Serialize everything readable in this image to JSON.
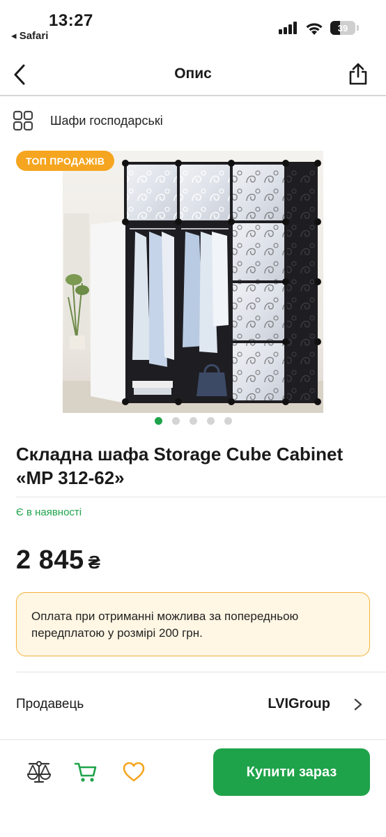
{
  "status": {
    "time": "13:27",
    "back_app": "◂ Safari",
    "battery": "39",
    "battery_level": 0.39
  },
  "header": {
    "title": "Опис"
  },
  "category": {
    "label": "Шафи господарські"
  },
  "product": {
    "badge": "ТОП ПРОДАЖІВ",
    "image_count": 5,
    "active_image": 1,
    "title": "Складна шафа Storage Cube Cabinet «MP 312-62»",
    "availability": "Є в наявності",
    "price": "2 845",
    "currency": "₴"
  },
  "notice": {
    "text": "Оплата при отриманні можлива за попередньою передплатою у розмірі 200 грн."
  },
  "seller": {
    "label": "Продавець",
    "name": "LVIGroup"
  },
  "bottom_bar": {
    "buy_label": "Купити зараз"
  },
  "colors": {
    "accent_green": "#1fa34a",
    "badge_orange": "#f5a51f",
    "notice_bg": "#fff6e3",
    "notice_border": "#f3b23a"
  }
}
